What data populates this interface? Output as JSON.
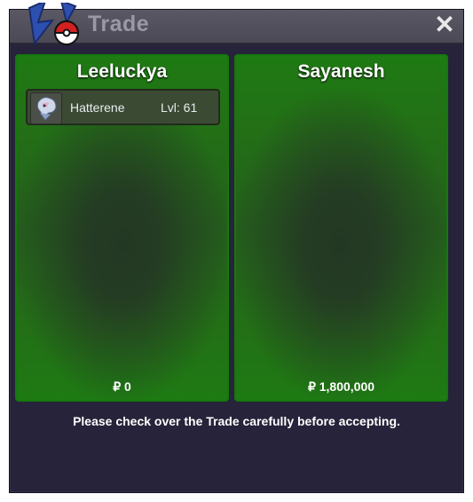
{
  "window": {
    "title": "Trade"
  },
  "left": {
    "name": "Leeluckya",
    "pokemon": [
      {
        "species": "Hatterene",
        "level": "Lvl: 61"
      }
    ],
    "money": "₽ 0"
  },
  "right": {
    "name": "Sayanesh",
    "money": "₽ 1,800,000"
  },
  "footer": {
    "message": "Please check over the Trade carefully before accepting."
  },
  "colors": {
    "panel": "#1e7a13",
    "window": "#26233a",
    "titlebar": "#4b4955"
  }
}
